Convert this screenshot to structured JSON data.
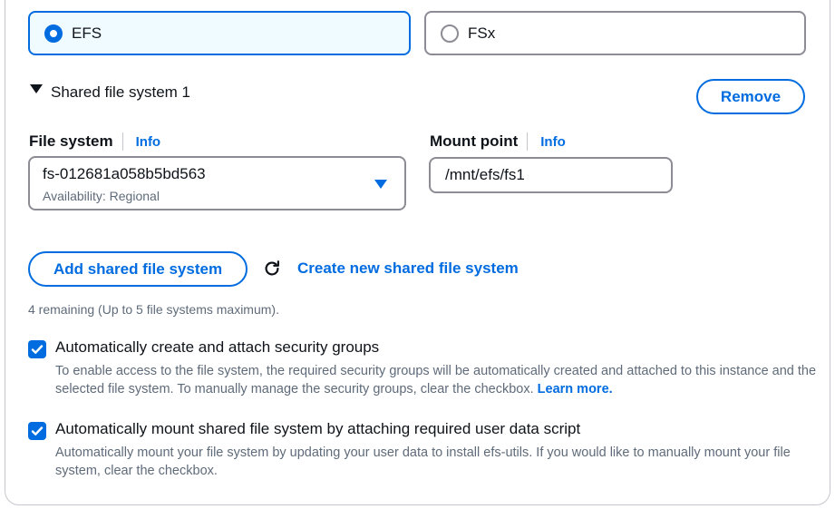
{
  "storage_type": {
    "options": [
      {
        "label": "EFS",
        "selected": true
      },
      {
        "label": "FSx",
        "selected": false
      }
    ]
  },
  "shared_fs": {
    "header": "Shared file system 1",
    "remove_label": "Remove",
    "file_system_label": "File system",
    "file_system_info": "Info",
    "file_system_value": "fs-012681a058b5bd563",
    "file_system_sub": "Availability: Regional",
    "mount_point_label": "Mount point",
    "mount_point_info": "Info",
    "mount_point_value": "/mnt/efs/fs1"
  },
  "actions": {
    "add_label": "Add shared file system",
    "create_label": "Create new shared file system"
  },
  "remaining_text": "4 remaining (Up to 5 file systems maximum).",
  "options": {
    "security_groups": {
      "checked": true,
      "title": "Automatically create and attach security groups",
      "desc": "To enable access to the file system, the required security groups will be automatically created and attached to this instance and the selected file system. To manually manage the security groups, clear the checkbox.",
      "link": "Learn more."
    },
    "auto_mount": {
      "checked": true,
      "title": "Automatically mount shared file system by attaching required user data script",
      "desc": "Automatically mount your file system by updating your user data to install efs-utils. If you would like to manually mount your file system, clear the checkbox."
    }
  },
  "colors": {
    "accent": "#006ce0",
    "selected_bg": "#f0fbff",
    "border": "#8c8c94",
    "muted_text": "#5f6b7a"
  }
}
